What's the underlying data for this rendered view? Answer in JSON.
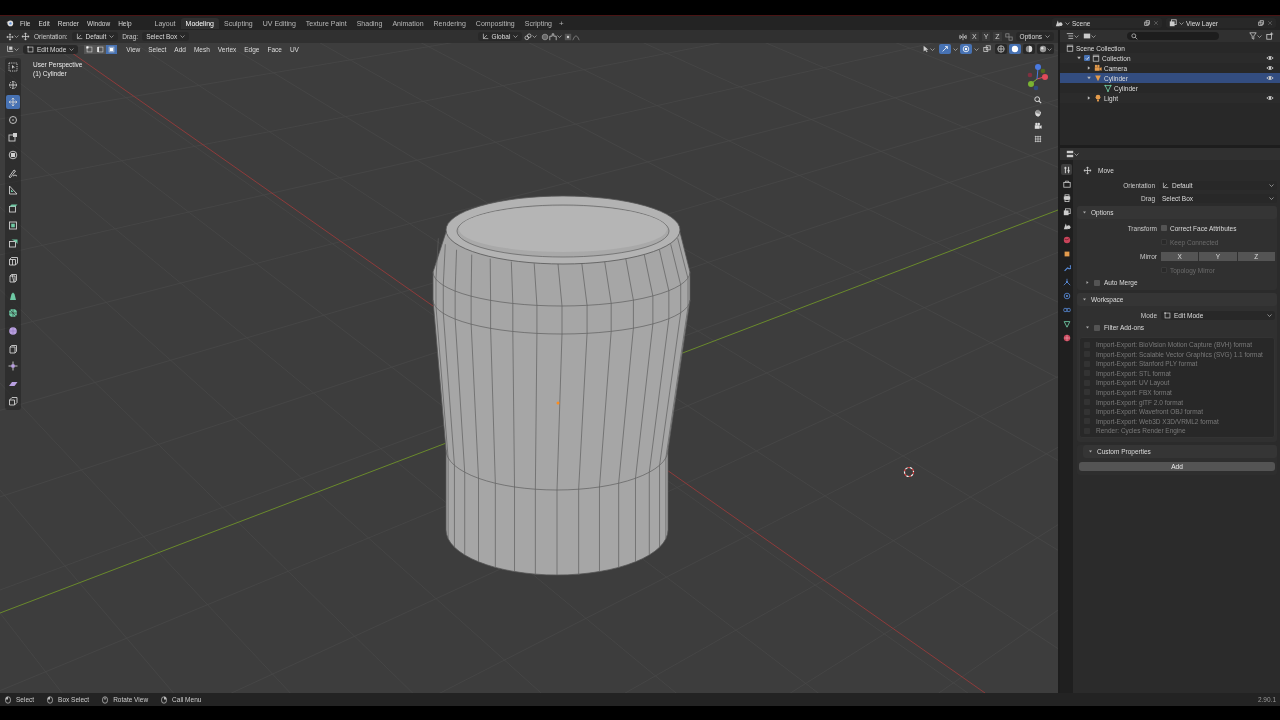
{
  "top_bar": {
    "menus": [
      "File",
      "Edit",
      "Render",
      "Window",
      "Help"
    ],
    "workspaces": [
      {
        "label": "Layout",
        "selected": false
      },
      {
        "label": "Modeling",
        "selected": true
      },
      {
        "label": "Sculpting",
        "selected": false
      },
      {
        "label": "UV Editing",
        "selected": false
      },
      {
        "label": "Texture Paint",
        "selected": false
      },
      {
        "label": "Shading",
        "selected": false
      },
      {
        "label": "Animation",
        "selected": false
      },
      {
        "label": "Rendering",
        "selected": false
      },
      {
        "label": "Compositing",
        "selected": false
      },
      {
        "label": "Scripting",
        "selected": false
      }
    ],
    "add_tab": "+",
    "scene": "Scene",
    "view_layer": "View Layer"
  },
  "tool_header": {
    "orientation_label": "Orientation:",
    "orientation": "Default",
    "drag_label": "Drag:",
    "drag": "Select Box",
    "transform_orientation": "Global",
    "axes": [
      "X",
      "Y",
      "Z"
    ],
    "options": "Options"
  },
  "viewport_header": {
    "mode": "Edit Mode",
    "select_modes": [
      {
        "kind": "vertex",
        "selected": false
      },
      {
        "kind": "edge",
        "selected": false
      },
      {
        "kind": "face",
        "selected": true
      }
    ],
    "menus": [
      "View",
      "Select",
      "Add",
      "Mesh",
      "Vertex",
      "Edge",
      "Face",
      "UV"
    ]
  },
  "viewport": {
    "view_name": "User Perspective",
    "object_name": "(1) Cylinder",
    "tools": [
      {
        "kind": "select-box",
        "selected": false
      },
      {
        "kind": "cursor",
        "selected": false
      },
      {
        "kind": "move",
        "selected": true
      },
      {
        "kind": "rotate",
        "selected": false
      },
      {
        "kind": "scale",
        "selected": false
      },
      {
        "kind": "transform",
        "selected": false
      },
      {
        "kind": "annotate",
        "selected": false
      },
      {
        "kind": "measure",
        "selected": false
      },
      {
        "kind": "extrude",
        "selected": false
      },
      {
        "kind": "inset",
        "selected": false
      },
      {
        "kind": "bevel",
        "selected": false
      },
      {
        "kind": "loop-cut",
        "selected": false
      },
      {
        "kind": "knife",
        "selected": false
      },
      {
        "kind": "poly-build",
        "selected": false
      },
      {
        "kind": "spin",
        "selected": false
      },
      {
        "kind": "smooth",
        "selected": false
      },
      {
        "kind": "edge-slide",
        "selected": false
      },
      {
        "kind": "shrink",
        "selected": false
      },
      {
        "kind": "shear",
        "selected": false
      },
      {
        "kind": "rip",
        "selected": false
      }
    ]
  },
  "outliner": {
    "tree": [
      {
        "label": "Scene Collection",
        "kind": "scene-collection",
        "selected": false,
        "children": [
          {
            "label": "Collection",
            "kind": "collection",
            "selected": false,
            "expanded": true,
            "checked": true,
            "visible": true,
            "children": [
              {
                "label": "Camera",
                "kind": "camera",
                "selected": false,
                "expanded": false,
                "visible": true
              },
              {
                "label": "Cylinder",
                "kind": "mesh-object",
                "selected": true,
                "expanded": true,
                "visible": true,
                "children": [
                  {
                    "label": "Cylinder",
                    "kind": "mesh-data",
                    "selected": false
                  }
                ]
              },
              {
                "label": "Light",
                "kind": "light",
                "selected": false,
                "expanded": false,
                "visible": true
              }
            ]
          }
        ]
      }
    ]
  },
  "properties": {
    "tabs": [
      {
        "kind": "tool",
        "selected": true
      },
      {
        "kind": "render",
        "selected": false
      },
      {
        "kind": "output",
        "selected": false
      },
      {
        "kind": "view-layer",
        "selected": false
      },
      {
        "kind": "scene",
        "selected": false
      },
      {
        "kind": "world",
        "selected": false
      },
      {
        "kind": "object",
        "selected": false
      },
      {
        "kind": "modifiers",
        "selected": false
      },
      {
        "kind": "particles",
        "selected": false
      },
      {
        "kind": "physics",
        "selected": false
      },
      {
        "kind": "constraints",
        "selected": false
      },
      {
        "kind": "data",
        "selected": false
      },
      {
        "kind": "material",
        "selected": false
      }
    ],
    "tool_name": "Move",
    "orientation_label": "Orientation",
    "orientation": "Default",
    "drag_label": "Drag",
    "drag": "Select Box",
    "sections": [
      {
        "kind": "panel",
        "title": "Options",
        "expanded": true,
        "rows": [
          {
            "kind": "checkbox",
            "label": "Transform",
            "text": "Correct Face Attributes",
            "checked": false,
            "disabled": false
          },
          {
            "kind": "checkbox",
            "text": "Keep Connected",
            "checked": false,
            "disabled": true
          },
          {
            "kind": "buttons",
            "label": "Mirror",
            "buttons": [
              "X",
              "Y",
              "Z"
            ]
          },
          {
            "kind": "checkbox",
            "text": "Topology Mirror",
            "checked": false,
            "disabled": true
          },
          {
            "kind": "subpanel",
            "text": "Auto Merge",
            "checked": false,
            "expanded": false
          }
        ]
      },
      {
        "kind": "panel",
        "title": "Workspace",
        "expanded": true,
        "rows": [
          {
            "kind": "dropdown",
            "label": "Mode",
            "value": "Edit Mode"
          },
          {
            "kind": "filter",
            "text": "Filter Add-ons",
            "checked": false,
            "expanded": true,
            "disabled": true,
            "addons": [
              {
                "label": "Import-Export: BioVision Motion Capture (BVH) format",
                "checked": false
              },
              {
                "label": "Import-Export: Scalable Vector Graphics (SVG) 1.1 format",
                "checked": false
              },
              {
                "label": "Import-Export: Stanford PLY format",
                "checked": false
              },
              {
                "label": "Import-Export: STL format",
                "checked": false
              },
              {
                "label": "Import-Export: UV Layout",
                "checked": false
              },
              {
                "label": "Import-Export: FBX format",
                "checked": false
              },
              {
                "label": "Import-Export: glTF 2.0 format",
                "checked": false
              },
              {
                "label": "Import-Export: Wavefront OBJ format",
                "checked": false
              },
              {
                "label": "Import-Export: Web3D X3D/VRML2 format",
                "checked": false
              },
              {
                "label": "Render: Cycles Render Engine",
                "checked": false
              }
            ]
          }
        ]
      },
      {
        "kind": "subpanel",
        "title": "Custom Properties",
        "expanded": true,
        "rows": [
          {
            "kind": "button",
            "text": "Add"
          }
        ]
      }
    ]
  },
  "status_bar": {
    "items": [
      {
        "kind": "mouse-left",
        "label": "Select"
      },
      {
        "kind": "mouse-drag",
        "label": "Box Select"
      },
      {
        "kind": "mouse-middle",
        "label": "Rotate View"
      },
      {
        "kind": "mouse-right",
        "label": "Call Menu"
      }
    ],
    "version": "2.90.1"
  }
}
